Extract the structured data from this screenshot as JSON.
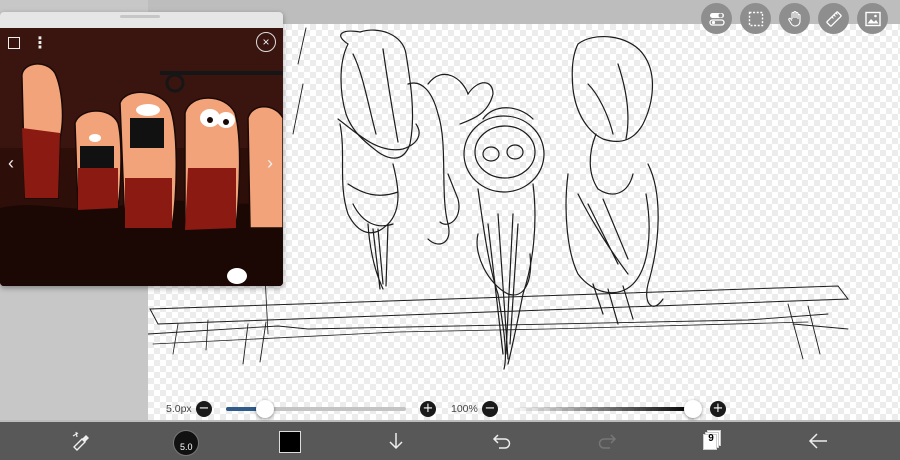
{
  "brush": {
    "size_label": "5.0px",
    "size_short": "5.0",
    "size_fraction": 0.21
  },
  "opacity": {
    "label": "100%",
    "fraction": 1.0
  },
  "slider_buttons": {
    "minus": "−",
    "plus": "+"
  },
  "color": {
    "current": "#000000",
    "accent": "#2f5b8a"
  },
  "layers": {
    "count": "9"
  },
  "reference": {
    "close_glyph": "×",
    "prev_glyph": "‹",
    "next_glyph": "›",
    "more_glyph": "⋮"
  },
  "top_tools": [
    {
      "name": "toggle-switch-icon"
    },
    {
      "name": "selection-icon"
    },
    {
      "name": "hand-icon"
    },
    {
      "name": "ruler-icon"
    },
    {
      "name": "material-image-icon"
    }
  ],
  "bottom_tools": [
    {
      "name": "eraser-brush-icon"
    },
    {
      "name": "brush-size-preview"
    },
    {
      "name": "color-swatch"
    },
    {
      "name": "download-arrow-icon"
    },
    {
      "name": "undo-icon"
    },
    {
      "name": "redo-icon"
    },
    {
      "name": "layers-icon"
    },
    {
      "name": "back-arrow-icon"
    }
  ]
}
